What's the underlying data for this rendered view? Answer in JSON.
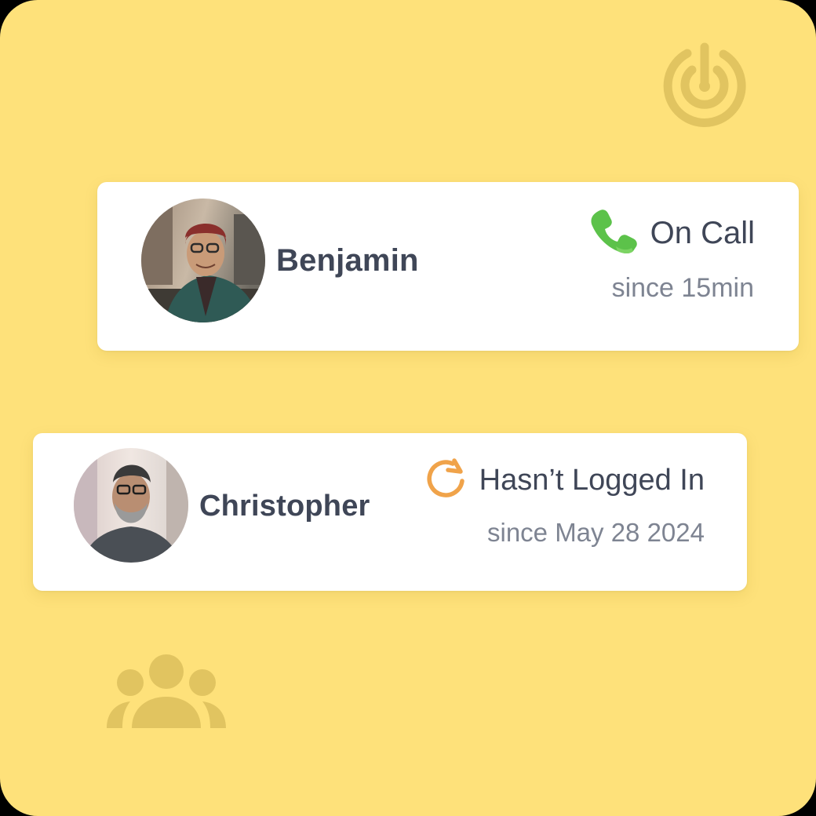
{
  "colors": {
    "background": "#FEE17A",
    "card": "#FFFFFF",
    "name_text": "#3F4657",
    "muted_text": "#7E8492",
    "on_call_green": "#5CC24A",
    "pending_orange": "#F0A34A",
    "decor_icon": "#E1C460"
  },
  "decor": {
    "top_icon": "radar-icon",
    "bottom_icon": "group-icon"
  },
  "users": [
    {
      "name": "Benjamin",
      "status": "On Call",
      "since": "since 15min",
      "status_icon": "phone-icon"
    },
    {
      "name": "Christopher",
      "status": "Hasn’t Logged In",
      "since": "since May 28 2024",
      "status_icon": "refresh-icon"
    }
  ]
}
